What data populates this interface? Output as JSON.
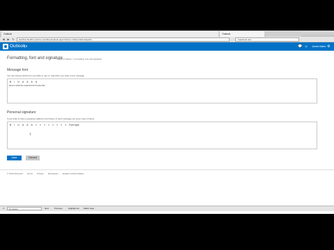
{
  "browser": {
    "tabs": [
      {
        "label": "Outlook"
      },
      {
        "label": "Outlook"
      },
      {
        "label": ""
      }
    ],
    "url": "blu181w.blu181.mail.live.com/#/opt/outlook.aspx?mkt=en-US&n=1&cl=1&path=...",
    "search_placeholder": "Facebook 4oa",
    "nav": {
      "back": "◀",
      "forward": "▶",
      "reload": "↻"
    }
  },
  "app": {
    "name": "Outlook",
    "chevron": "|∨",
    "user_name": "James Bates",
    "icons": {
      "chat": "💬",
      "people": "☺",
      "settings": "⚙"
    }
  },
  "page": {
    "title": "Formatting, font and signature",
    "breadcrumb": "Make it Outlook > Formatting, font and signature"
  },
  "message_font": {
    "heading": "Message font",
    "description": "You can choose which font you'd like to use on mail when you write a new message.",
    "toolbar": [
      "B",
      "I",
      "U",
      "A",
      "A",
      "A",
      "A"
    ],
    "sample": "Here's what the selected font looks like."
  },
  "signature": {
    "heading": "Personal signature",
    "description": "If you'd like to have a signature added to the bottom of each message you send, enter it below.",
    "toolbar": [
      "B",
      "I",
      "U",
      "A",
      "A",
      "A",
      "≡",
      "≡",
      "≡",
      "≡",
      "≡",
      "≡",
      "≡",
      "≡",
      "Font type"
    ],
    "cursor": "I"
  },
  "actions": {
    "save": "Save",
    "discard": "Discard"
  },
  "footer": [
    "© 2012 Microsoft",
    "Terms",
    "Privacy",
    "Developers",
    "English (United States)"
  ],
  "findbar": {
    "close": "✕",
    "query": "Q mycom",
    "buttons": [
      "Next",
      "Previous",
      "Highlight all",
      "Match case"
    ],
    "status": ""
  }
}
